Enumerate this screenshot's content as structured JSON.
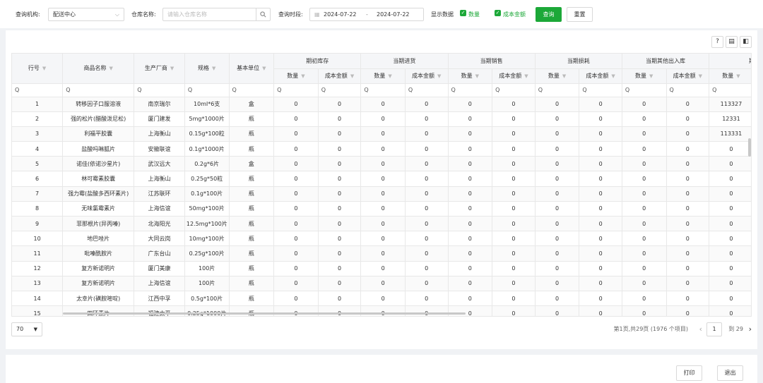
{
  "filters": {
    "org_label": "查询机构:",
    "org_value": "配送中心",
    "warehouse_label": "仓库名称:",
    "warehouse_placeholder": "请输入仓库名称",
    "period_label": "查询时段:",
    "date_start": "2024-07-22",
    "date_sep": "-",
    "date_end": "2024-07-22",
    "display_label": "显示数据",
    "chk_qty": "数量",
    "chk_amount": "成本金额",
    "query_btn": "查询",
    "reset_btn": "重置"
  },
  "colors": {
    "accent": "#1ca838",
    "header_bg": "#f5f6f8"
  },
  "table": {
    "fixed_headers": [
      "行号",
      "商品名称",
      "生产厂商",
      "规格",
      "基本单位"
    ],
    "groups": [
      "期初库存",
      "当期进货",
      "当期销售",
      "当期损耗",
      "当期其他出入库",
      "期末库"
    ],
    "sub_qty": "数量",
    "sub_amt": "成本金额",
    "filter_icon": "Q",
    "rows": [
      {
        "no": "1",
        "name": "转移因子口服溶液",
        "maker": "南京瑞尔",
        "spec": "10ml*6支",
        "unit": "盒",
        "vals": [
          "0",
          "0",
          "0",
          "0",
          "0",
          "0",
          "0",
          "0",
          "0",
          "0",
          "113327"
        ]
      },
      {
        "no": "2",
        "name": "强的松片(醋酸泼尼松)",
        "maker": "厦门建发",
        "spec": "5mg*1000片",
        "unit": "瓶",
        "vals": [
          "0",
          "0",
          "0",
          "0",
          "0",
          "0",
          "0",
          "0",
          "0",
          "0",
          "12331"
        ]
      },
      {
        "no": "3",
        "name": "利福平胶囊",
        "maker": "上海衡山",
        "spec": "0.15g*100粒",
        "unit": "瓶",
        "vals": [
          "0",
          "0",
          "0",
          "0",
          "0",
          "0",
          "0",
          "0",
          "0",
          "0",
          "113331"
        ]
      },
      {
        "no": "4",
        "name": "盐酸吗啉胍片",
        "maker": "安徽联谊",
        "spec": "0.1g*1000片",
        "unit": "瓶",
        "vals": [
          "0",
          "0",
          "0",
          "0",
          "0",
          "0",
          "0",
          "0",
          "0",
          "0",
          "0"
        ]
      },
      {
        "no": "5",
        "name": "诺佳(依诺沙星片)",
        "maker": "武汉远大",
        "spec": "0.2g*6片",
        "unit": "盒",
        "vals": [
          "0",
          "0",
          "0",
          "0",
          "0",
          "0",
          "0",
          "0",
          "0",
          "0",
          "0"
        ]
      },
      {
        "no": "6",
        "name": "林可霉素胶囊",
        "maker": "上海衡山",
        "spec": "0.25g*50粒",
        "unit": "瓶",
        "vals": [
          "0",
          "0",
          "0",
          "0",
          "0",
          "0",
          "0",
          "0",
          "0",
          "0",
          "0"
        ]
      },
      {
        "no": "7",
        "name": "强力霉(盐酸多西环素片)",
        "maker": "江苏联环",
        "spec": "0.1g*100片",
        "unit": "瓶",
        "vals": [
          "0",
          "0",
          "0",
          "0",
          "0",
          "0",
          "0",
          "0",
          "0",
          "0",
          "0"
        ]
      },
      {
        "no": "8",
        "name": "无味氯霉素片",
        "maker": "上海信谊",
        "spec": "50mg*100片",
        "unit": "瓶",
        "vals": [
          "0",
          "0",
          "0",
          "0",
          "0",
          "0",
          "0",
          "0",
          "0",
          "0",
          "0"
        ]
      },
      {
        "no": "9",
        "name": "菲那根片(异丙嗪)",
        "maker": "北海阳光",
        "spec": "12.5mg*100片",
        "unit": "瓶",
        "vals": [
          "0",
          "0",
          "0",
          "0",
          "0",
          "0",
          "0",
          "0",
          "0",
          "0",
          "0"
        ]
      },
      {
        "no": "10",
        "name": "地巴唑片",
        "maker": "大同云岗",
        "spec": "10mg*100片",
        "unit": "瓶",
        "vals": [
          "0",
          "0",
          "0",
          "0",
          "0",
          "0",
          "0",
          "0",
          "0",
          "0",
          "0"
        ]
      },
      {
        "no": "11",
        "name": "吡嗪酰胺片",
        "maker": "广东台山",
        "spec": "0.25g*100片",
        "unit": "瓶",
        "vals": [
          "0",
          "0",
          "0",
          "0",
          "0",
          "0",
          "0",
          "0",
          "0",
          "0",
          "0"
        ]
      },
      {
        "no": "12",
        "name": "复方新诺明片",
        "maker": "厦门美康",
        "spec": "100片",
        "unit": "瓶",
        "vals": [
          "0",
          "0",
          "0",
          "0",
          "0",
          "0",
          "0",
          "0",
          "0",
          "0",
          "0"
        ]
      },
      {
        "no": "13",
        "name": "复方新诺明片",
        "maker": "上海信谊",
        "spec": "100片",
        "unit": "瓶",
        "vals": [
          "0",
          "0",
          "0",
          "0",
          "0",
          "0",
          "0",
          "0",
          "0",
          "0",
          "0"
        ]
      },
      {
        "no": "14",
        "name": "太幸片(磺胺嘧啶)",
        "maker": "江西中孚",
        "spec": "0.5g*100片",
        "unit": "瓶",
        "vals": [
          "0",
          "0",
          "0",
          "0",
          "0",
          "0",
          "0",
          "0",
          "0",
          "0",
          "0"
        ]
      },
      {
        "no": "15",
        "name": "四环素片",
        "maker": "福建太平",
        "spec": "0.25g*1000片",
        "unit": "瓶",
        "vals": [
          "0",
          "0",
          "0",
          "0",
          "0",
          "0",
          "0",
          "0",
          "0",
          "0",
          "0"
        ]
      }
    ]
  },
  "pager": {
    "page_size": "70",
    "info": "第1页,共29页 (1976 个项目)",
    "current": "1",
    "total": "到 29"
  },
  "footer": {
    "print_btn": "打印",
    "exit_btn": "退出"
  }
}
